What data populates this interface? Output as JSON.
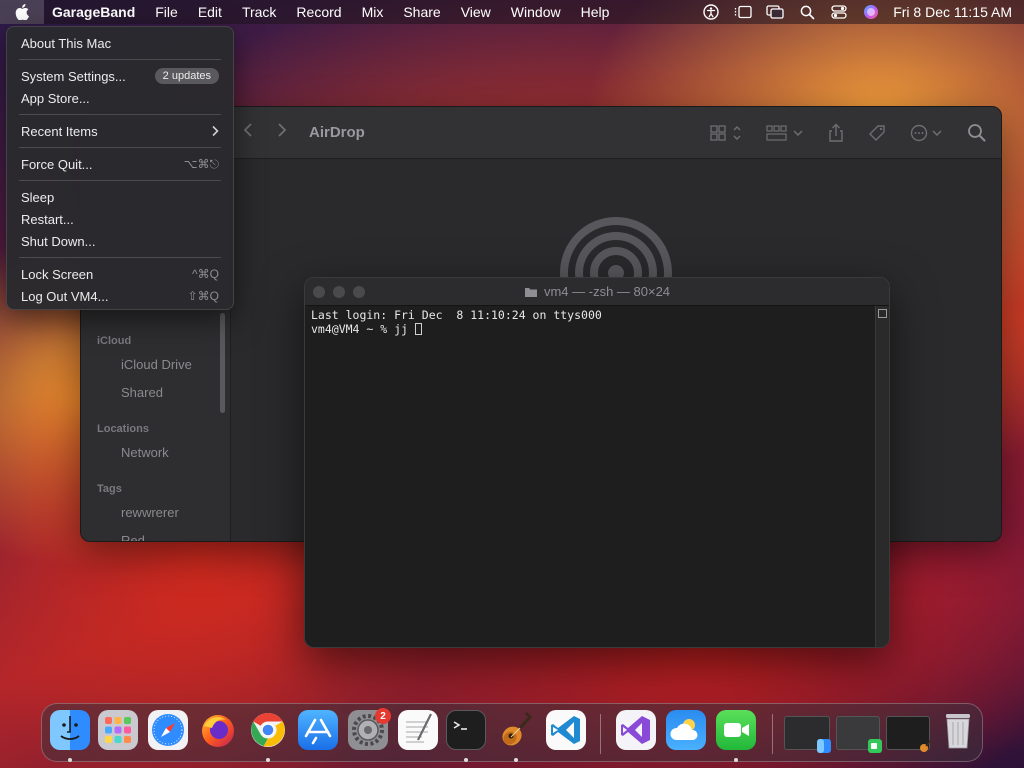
{
  "menubar": {
    "app_name": "GarageBand",
    "items": [
      "File",
      "Edit",
      "Track",
      "Record",
      "Mix",
      "Share",
      "View",
      "Window",
      "Help"
    ],
    "clock": "Fri 8 Dec  11:15 AM"
  },
  "apple_menu": {
    "about": "About This Mac",
    "system_settings": "System Settings...",
    "updates_badge": "2 updates",
    "app_store": "App Store...",
    "recent_items": "Recent Items",
    "force_quit": "Force Quit...",
    "force_quit_shortcut": "⌥⌘⎋",
    "sleep": "Sleep",
    "restart": "Restart...",
    "shut_down": "Shut Down...",
    "lock_screen": "Lock Screen",
    "lock_screen_shortcut": "^⌘Q",
    "log_out": "Log Out VM4...",
    "log_out_shortcut": "⇧⌘Q"
  },
  "finder": {
    "title": "AirDrop",
    "sidebar": {
      "icloud_header": "iCloud",
      "icloud_drive": "iCloud Drive",
      "shared": "Shared",
      "locations_header": "Locations",
      "network": "Network",
      "tags_header": "Tags",
      "tag1": "rewwrerer",
      "tag2": "Red"
    }
  },
  "terminal": {
    "title": "vm4 — -zsh — 80×24",
    "line1": "Last login: Fri Dec  8 11:10:24 on ttys000",
    "line2_prompt": "vm4@VM4 ~ % jj "
  },
  "dock": {
    "settings_badge": "2",
    "apps": [
      "Finder",
      "Launchpad",
      "Safari",
      "Firefox",
      "Chrome",
      "App Store",
      "System Settings",
      "TextEdit",
      "Terminal",
      "GarageBand",
      "VS Code",
      "Visual Studio",
      "Weather",
      "FaceTime"
    ]
  },
  "colors": {
    "menu_bg": "#2a2a2e",
    "terminal_bg": "#1e1e1e",
    "finder_bg": "#2a2a2c",
    "badge_red": "#e5392f"
  }
}
